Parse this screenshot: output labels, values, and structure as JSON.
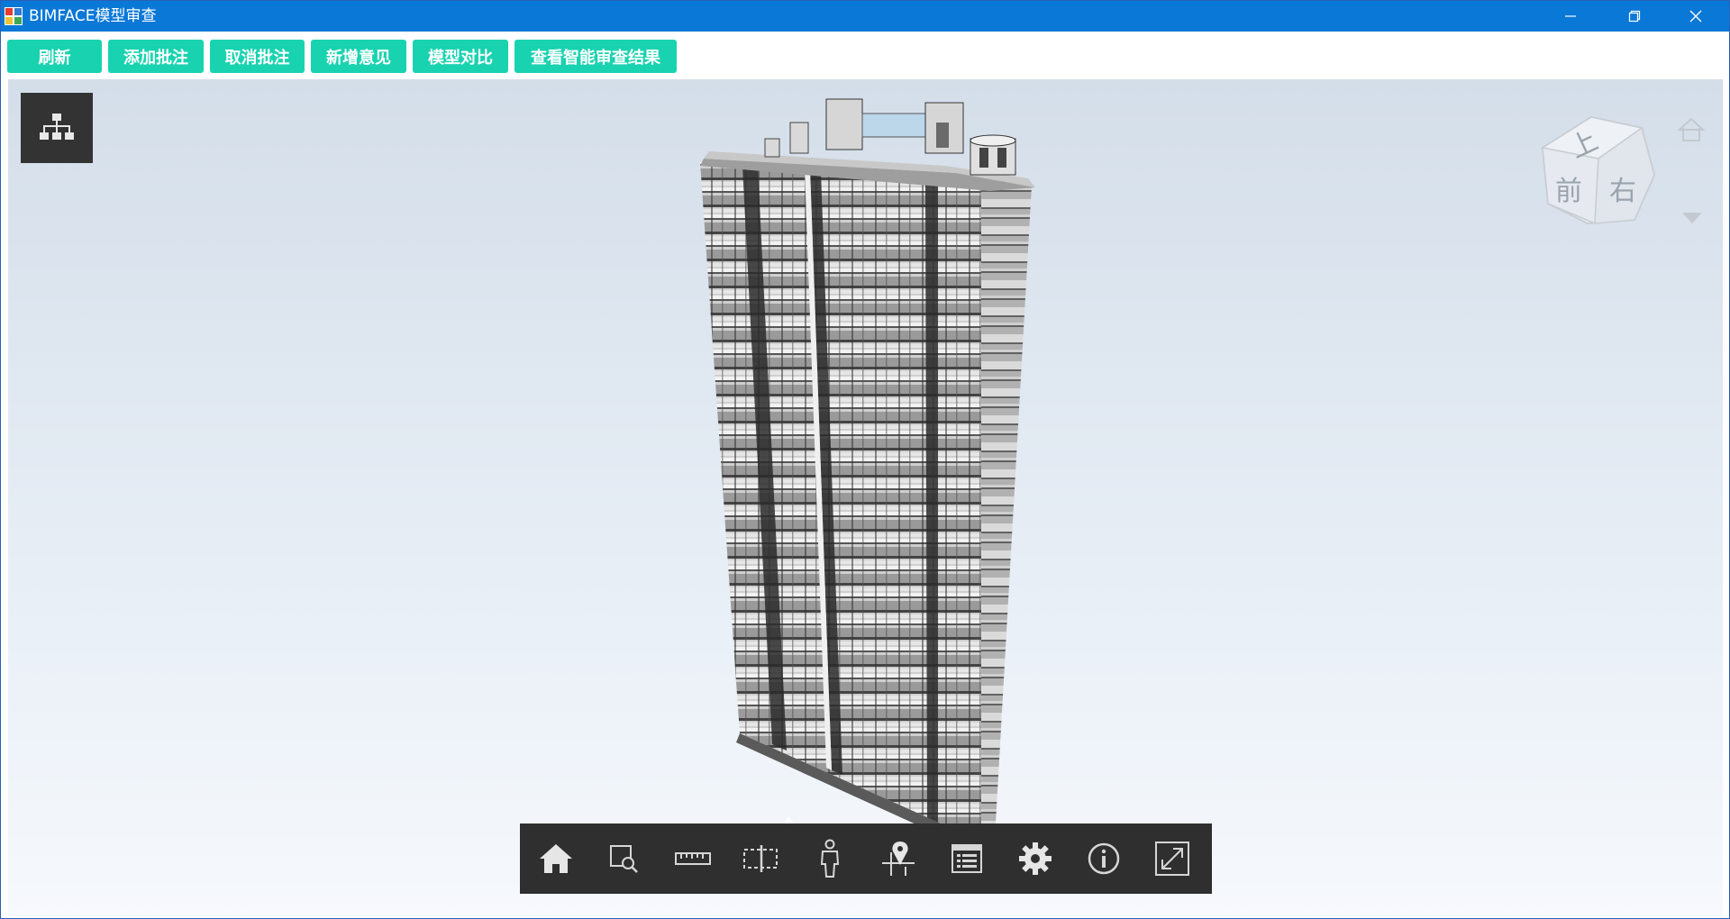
{
  "window": {
    "title": "BIMFACE模型审查",
    "controls": [
      "minimize",
      "restore",
      "close"
    ]
  },
  "toolbar": {
    "buttons": [
      {
        "label": "刷新"
      },
      {
        "label": "添加批注"
      },
      {
        "label": "取消批注"
      },
      {
        "label": "新增意见"
      },
      {
        "label": "模型对比"
      },
      {
        "label": "查看智能审查结果"
      }
    ],
    "button_color": "#19d3b0"
  },
  "viewer": {
    "model_tree_icon": "hierarchy-icon",
    "viewcube": {
      "faces": {
        "front": "前",
        "right": "右",
        "top": "上"
      },
      "home_icon": "home-outline-icon",
      "menu_icon": "triangle-down-icon"
    },
    "bottom_toolbar": [
      {
        "name": "home",
        "icon": "home-icon"
      },
      {
        "name": "zoom-box",
        "icon": "zoom-box-icon"
      },
      {
        "name": "measure",
        "icon": "ruler-icon"
      },
      {
        "name": "section",
        "icon": "section-box-icon"
      },
      {
        "name": "walk",
        "icon": "person-icon"
      },
      {
        "name": "map",
        "icon": "map-pin-icon"
      },
      {
        "name": "properties",
        "icon": "list-icon"
      },
      {
        "name": "settings",
        "icon": "gear-icon"
      },
      {
        "name": "info",
        "icon": "info-icon"
      },
      {
        "name": "fullscreen",
        "icon": "fullscreen-icon"
      }
    ]
  }
}
